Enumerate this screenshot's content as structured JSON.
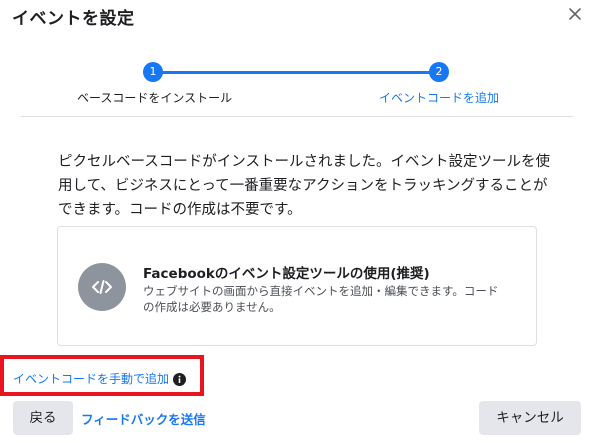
{
  "dialog": {
    "title": "イベントを設定",
    "close_icon": "close-icon"
  },
  "stepper": {
    "steps": [
      {
        "number": "1",
        "label": "ベースコードをインストール",
        "state": "completed"
      },
      {
        "number": "2",
        "label": "イベントコードを追加",
        "state": "active"
      }
    ]
  },
  "intro": {
    "lines": [
      "ピクセルベースコードがインストールされました。イベント設定ツールを使",
      "用して、ビジネスにとって一番重要なアクションをトラッキングすることが",
      "できます。コードの作成は不要です。"
    ]
  },
  "option_card": {
    "icon": "code-icon",
    "title": "Facebookのイベント設定ツールの使用(推奨)",
    "description_lines": [
      "ウェブサイトの画面から直接イベントを追加・編集できます。コード",
      "の作成は必要ありません。"
    ]
  },
  "manual_link": {
    "label": "イベントコードを手動で追加",
    "icon": "info-icon"
  },
  "footer": {
    "back_label": "戻る",
    "feedback_label": "フィードバックを送信",
    "cancel_label": "キャンセル"
  },
  "colors": {
    "accent": "#1877f2",
    "highlight": "#e8141e",
    "button_bg": "#e4e6eb",
    "icon_bg": "#8d949e"
  }
}
